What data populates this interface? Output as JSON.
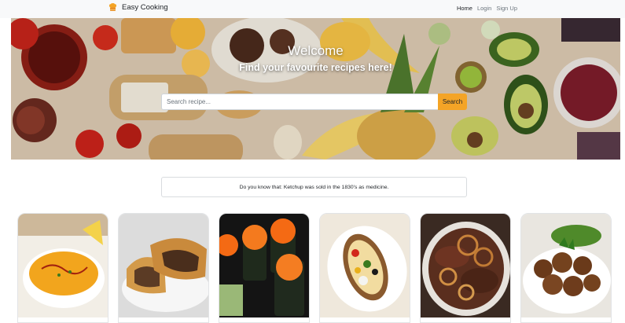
{
  "navbar": {
    "brand": "Easy Cooking",
    "brand_icon": "chef-hat-icon",
    "links": [
      {
        "label": "Home",
        "active": true
      },
      {
        "label": "Login",
        "active": false
      },
      {
        "label": "Sign Up",
        "active": false
      }
    ]
  },
  "hero": {
    "title": "Welcome",
    "subtitle": "Find your favourite recipes here!",
    "search": {
      "placeholder": "Search recipe...",
      "button": "Search"
    }
  },
  "fact": {
    "text": "Do you know that: Ketchup was sold in the 1830's as medicine."
  },
  "colors": {
    "accent": "#f4a426",
    "navbar_bg": "#f8f9fa"
  },
  "cards": [
    {
      "dish": "soup"
    },
    {
      "dish": "meat-pie"
    },
    {
      "dish": "sushi-rolls"
    },
    {
      "dish": "baked-potato"
    },
    {
      "dish": "liver-with-onions"
    },
    {
      "dish": "falafel"
    }
  ]
}
